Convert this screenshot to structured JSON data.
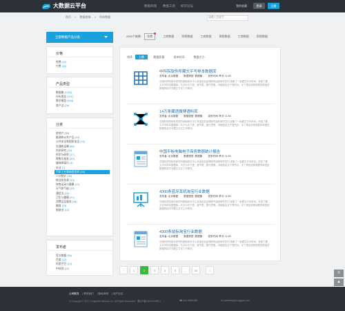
{
  "header": {
    "brand": "大数据云平台",
    "nav": [
      "数据商城",
      "数据工具",
      "知识论坛"
    ],
    "search_placeholder": "",
    "user": "我的收藏",
    "login": "登录",
    "register": "注册"
  },
  "breadcrumb": [
    "首页",
    ">",
    "数据商城",
    ">",
    "所有数据"
  ],
  "sidebar": {
    "all_button": "全部数据产品分类",
    "price": {
      "title": "价格",
      "items": [
        {
          "label": "免费",
          "count": "(12)"
        },
        {
          "label": "付费",
          "count": "(34)"
        }
      ]
    },
    "type": {
      "title": "产品类型",
      "items": [
        {
          "label": "数据集",
          "count": "(1023)"
        },
        {
          "label": "分析报告",
          "count": "(321)"
        },
        {
          "label": "数学模型",
          "count": "(544)"
        },
        {
          "label": "其产品",
          "count": "(24)"
        }
      ]
    },
    "category": {
      "title": "分类",
      "items": [
        {
          "label": "房地产",
          "count": "(56)"
        },
        {
          "label": "能源和公共产品",
          "count": "(21)"
        },
        {
          "label": "公共安全和国家安全",
          "count": "(22)"
        },
        {
          "label": "交通和运输",
          "count": "(66)"
        },
        {
          "label": "科学研究",
          "count": "(43)"
        },
        {
          "label": "科学与研究",
          "count": "(17)"
        },
        {
          "label": "零售及批发",
          "count": "(43)"
        },
        {
          "label": "媒体和娱乐",
          "count": "(4)"
        },
        {
          "label": "农业",
          "count": "(7)"
        },
        {
          "label": "汽车工业和新型农村",
          "count": "(34)",
          "active": true
        },
        {
          "label": "人口统计",
          "count": "(35)"
        },
        {
          "label": "商业和贸易",
          "count": "(43)"
        },
        {
          "label": "体育运动与健康",
          "count": "(12)"
        },
        {
          "label": "天气和气候",
          "count": "(15)"
        },
        {
          "label": "通信业",
          "count": "(22)"
        },
        {
          "label": "卫生与健康",
          "count": "(21)"
        },
        {
          "label": "消费品及服务",
          "count": "(18)"
        },
        {
          "label": "教育",
          "count": "(23)"
        },
        {
          "label": "制造业",
          "count": "(12)"
        }
      ]
    },
    "publisher": {
      "title": "发布者",
      "items": [
        {
          "label": "官方数据",
          "count": "(56)"
        },
        {
          "label": "百度",
          "count": "(12)"
        },
        {
          "label": "阿里巴巴",
          "count": "(12)"
        },
        {
          "label": "中科院",
          "count": "(22)"
        }
      ]
    }
  },
  "filters": {
    "total": "2000个结果:",
    "tabs": [
      "免费",
      "工商数据",
      "财税数据",
      "工商数据",
      "财税数据",
      "工商数据",
      "财税数据"
    ]
  },
  "sort": {
    "label": "排序:",
    "options": [
      "分数",
      "数据质量",
      "发布时间",
      "数据大小"
    ]
  },
  "items": [
    {
      "title": "中科院软件所藏文平写样本数据库",
      "publisher": "发布者: 北京数据",
      "type": "数据类型: 数据集",
      "time": "发布时间: 昨天 11:50",
      "desc": "中国科学院软件研究所基础软件中心多语言信息理研究组的研究员们,采集了一批藏文平写样本。完成了藏文平写样本数据库。共分为手下表、音节表、整行表等。详细信息见下表所示。字了再加说明有藏学和语言数据构成平写藏文文字工作情况。",
      "icon": "grid"
    },
    {
      "title": "14万条藏语微博语料库",
      "publisher": "发布者: 北京数据",
      "type": "数据类型: 数据集",
      "time": "发布时间: 昨天 11:50",
      "desc": "中国科学院软件研究所基础软件中心多语言信息理研究组的研究员们,采集了一批藏文平写样本。完成了藏文平写样本数据库。共分为手下表、音节表、整行表等。详细信息见下表所示。字了再加说明有藏学和语言数据构成平写藏文文字工作情况。",
      "icon": "network"
    },
    {
      "title": "中国平板电脑电子商务数据统计报告",
      "publisher": "发布者: 北京数据",
      "type": "数据类型: 数据集",
      "time": "发布时间: 昨天 11:50",
      "desc": "中国科学院软件研究所基础软件中心多语言信息理研究组的研究员们,采集了一批藏文平写样本。完成了藏文平写样本数据库。共分为手下表、音节表、整行表等。详细信息见下表所示。字了再加说明有藏学和语言数据构成平写藏文文字工作情况。",
      "icon": "report"
    },
    {
      "title": "4300条蓝牙耳机淘宝行业数据",
      "publisher": "发布者: 北京数据",
      "type": "数据类型: 数据集",
      "time": "发布时间: 昨天 11:50",
      "desc": "中国科学院软件研究所基础软件中心多语言信息理研究组的研究员们,采集了一批藏文平写样本。完成了藏文平写样本数据库。共分为手下表、音节表、整行表等。详细信息见下表所示。字了再加说明有藏学和语言数据构成平写藏文文字工作情况。",
      "icon": "presentation"
    },
    {
      "title": "4300条鼠标淘宝行业数据",
      "publisher": "发布者: 北京数据",
      "type": "数据类型: 数据集",
      "time": "发布时间: 昨天 11:50",
      "desc": "中国科学院软件研究所基础软件中心多语言信息理研究组的研究员们,采集了一批藏文平写样本。完成了藏文平写样本数据库。共分为手下表、音节表、整行表等。详细信息见下表所示。字了再加说明有藏学和语言数据构成平写藏文文字工作情况。",
      "icon": "report"
    }
  ],
  "pager": {
    "items": [
      "‹",
      "1",
      "2",
      "3",
      "4",
      "5",
      "...",
      "10",
      "›"
    ],
    "current": "2"
  },
  "footer": {
    "links": [
      "公司概况",
      "联系我们",
      "隐私声明",
      "用户协议"
    ],
    "copyright": "© Copyright © 2017 LongGold Sichuan Co. All Rights Reserved",
    "icp": "蜀ICP备13016128号-1",
    "phone": "400-8888-888",
    "email": "marketing@longgold.com"
  },
  "colors": {
    "accent": "#1aa0dc",
    "header": "#2c3038",
    "link": "#1f6fb2",
    "pager_active": "#3cb93c"
  }
}
